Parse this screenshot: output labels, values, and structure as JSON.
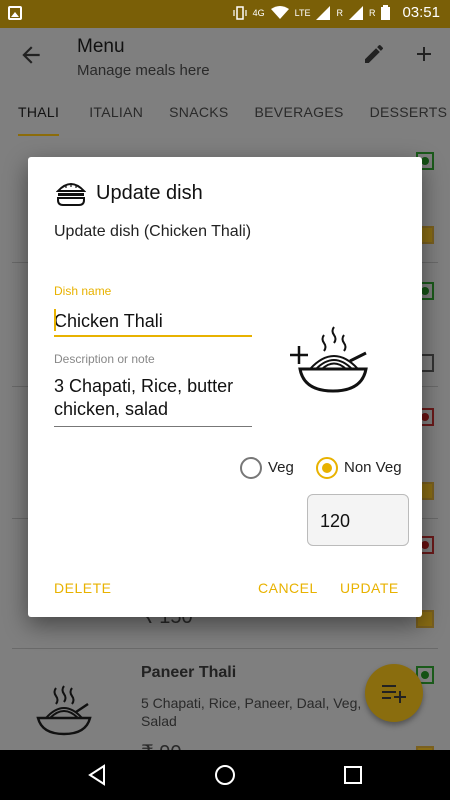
{
  "status_bar": {
    "network_label": "4G",
    "lte_label": "LTE",
    "roaming_label_1": "R",
    "roaming_label_2": "R",
    "time": "03:51"
  },
  "app_bar": {
    "title": "Menu",
    "subtitle": "Manage meals here"
  },
  "tabs": [
    {
      "label": "THALI",
      "active": true
    },
    {
      "label": "ITALIAN",
      "active": false
    },
    {
      "label": "SNACKS",
      "active": false
    },
    {
      "label": "BEVERAGES",
      "active": false
    },
    {
      "label": "DESSERTS",
      "active": false
    }
  ],
  "background_list": {
    "visible_price_top": "₹ 150",
    "visible_item": {
      "title": "Paneer Thali",
      "description": "5 Chapati, Rice, Paneer, Daal, Veg, Salad",
      "price_partial": "₹ 90"
    }
  },
  "dialog": {
    "title": "Update dish",
    "subtitle": "Update dish (Chicken Thali)",
    "dish_name_label": "Dish name",
    "dish_name_value": "Chicken Thali",
    "description_label": "Description or note",
    "description_value": "3 Chapati, Rice, butter chicken, salad",
    "veg_label": "Veg",
    "nonveg_label": "Non Veg",
    "selected_type": "Non Veg",
    "price_value": "120",
    "delete_label": "DELETE",
    "cancel_label": "CANCEL",
    "update_label": "UPDATE"
  },
  "colors": {
    "accent": "#e8b200",
    "scrim_bg": "#7f7f7f"
  }
}
